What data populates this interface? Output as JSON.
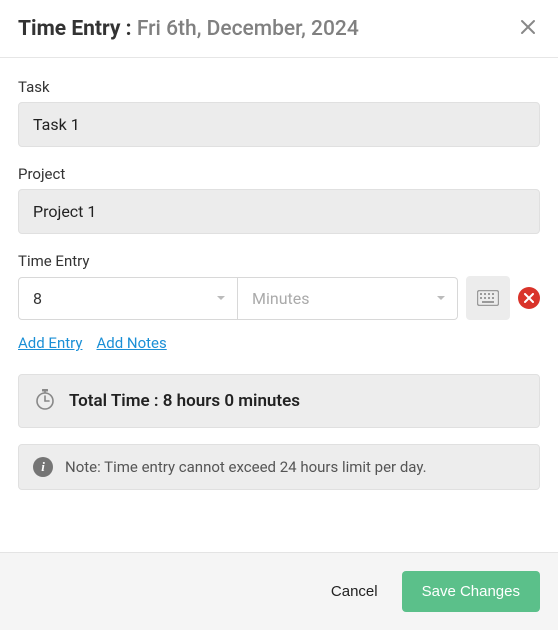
{
  "header": {
    "title_prefix": "Time Entry : ",
    "date": "Fri 6th, December, 2024"
  },
  "task": {
    "label": "Task",
    "value": "Task 1"
  },
  "project": {
    "label": "Project",
    "value": "Project 1"
  },
  "timeEntry": {
    "label": "Time Entry",
    "hours_value": "8",
    "minutes_placeholder": "Minutes"
  },
  "links": {
    "add_entry": "Add Entry",
    "add_notes": "Add Notes"
  },
  "total": {
    "text": "Total Time : 8 hours 0 minutes"
  },
  "note": {
    "text": "Note: Time entry cannot exceed 24 hours limit per day."
  },
  "footer": {
    "cancel": "Cancel",
    "save": "Save Changes"
  }
}
